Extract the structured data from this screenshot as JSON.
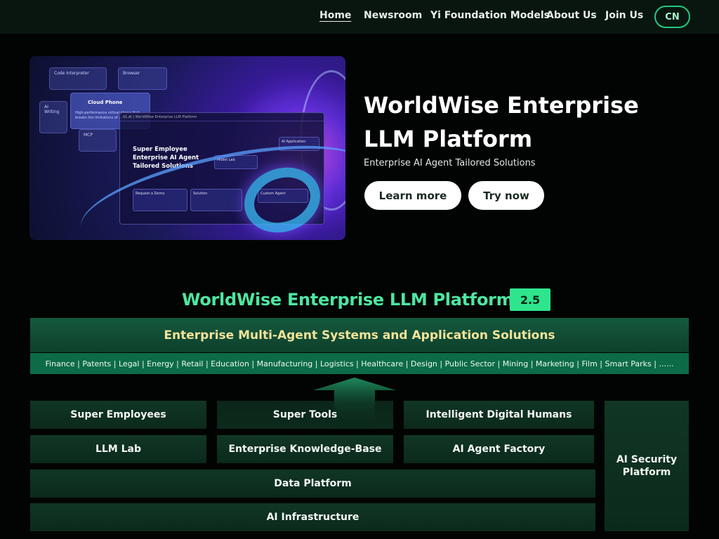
{
  "nav": {
    "items": [
      "Home",
      "Newsroom",
      "Yi Foundation Models",
      "About Us",
      "Join Us"
    ],
    "lang": "CN"
  },
  "hero": {
    "title": "WorldWise Enterprise LLM Platform",
    "subtitle": "Enterprise AI Agent Tailored Solutions",
    "learn_more": "Learn more",
    "try_now": "Try now",
    "image": {
      "cards": [
        "Code Interpreter",
        "Browser",
        "Cloud Phone",
        "AI Writing",
        "MCP"
      ],
      "cloud_phone_desc": "High-performance virtual phone that breaks the limitations of physical...",
      "window_title": "01.AI | WorldWise Enterprise LLM Platform",
      "headline": [
        "Super Employee",
        "Enterprise AI Agent",
        "Tailored Solutions"
      ],
      "boxes": [
        "AI Application",
        "Model Lab",
        "Custom Agent",
        "Request a Demo",
        "Solution"
      ]
    }
  },
  "architecture": {
    "title": "WorldWise Enterprise LLM Platform",
    "version": "2.5",
    "top_band": "Enterprise Multi-Agent Systems and Application Solutions",
    "industries": "Finance | Patents | Legal | Energy | Retail | Education | Manufacturing | Logistics | Healthcare | Design | Public Sector | Mining | Marketing | Film | Smart Parks | ......",
    "row1": [
      "Super Employees",
      "Super Tools",
      "Intelligent Digital Humans"
    ],
    "row2": [
      "LLM Lab",
      "Enterprise Knowledge-Base",
      "AI Agent Factory"
    ],
    "data_platform": "Data Platform",
    "ai_infrastructure": "AI Infrastructure",
    "security": "AI Security Platform",
    "colors": {
      "accent": "#2ee58e",
      "title_green": "#4ee6a1",
      "band_text": "#f2e39a"
    }
  }
}
